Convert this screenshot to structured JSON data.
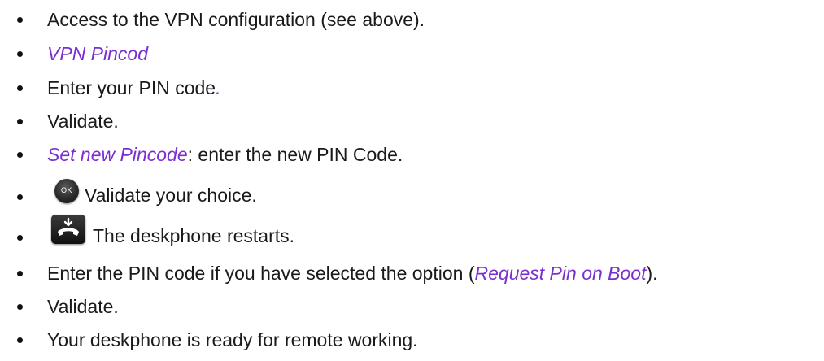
{
  "instructions": [
    {
      "parts": [
        {
          "text": "Access to the VPN configuration (see above)."
        }
      ]
    },
    {
      "parts": [
        {
          "text": "VPN Pincod",
          "style": "italic"
        }
      ]
    },
    {
      "parts": [
        {
          "text": "Enter your PIN code"
        },
        {
          "text": ".",
          "style": "italic"
        }
      ]
    },
    {
      "parts": [
        {
          "text": "Validate."
        }
      ]
    },
    {
      "parts": [
        {
          "text": "Set new Pincode",
          "style": "italic"
        },
        {
          "text": ": enter the new PIN Code."
        }
      ]
    },
    {
      "icon": "ok-key-icon",
      "icon_label": "OK",
      "parts": [
        {
          "text": "Validate your choice."
        }
      ]
    },
    {
      "icon": "hang-up-key-icon",
      "parts": [
        {
          "text": "The deskphone restarts."
        }
      ]
    },
    {
      "parts": [
        {
          "text": "Enter the PIN code if you have selected the option ("
        },
        {
          "text": "Request Pin on Boot",
          "style": "italic"
        },
        {
          "text": ")."
        }
      ]
    },
    {
      "parts": [
        {
          "text": "Validate."
        }
      ]
    },
    {
      "parts": [
        {
          "text": "Your deskphone is ready for remote working."
        }
      ]
    }
  ],
  "colors": {
    "text": "#1a1a1a",
    "italic_link": "#7a2fd0",
    "bullet": "#111111"
  }
}
